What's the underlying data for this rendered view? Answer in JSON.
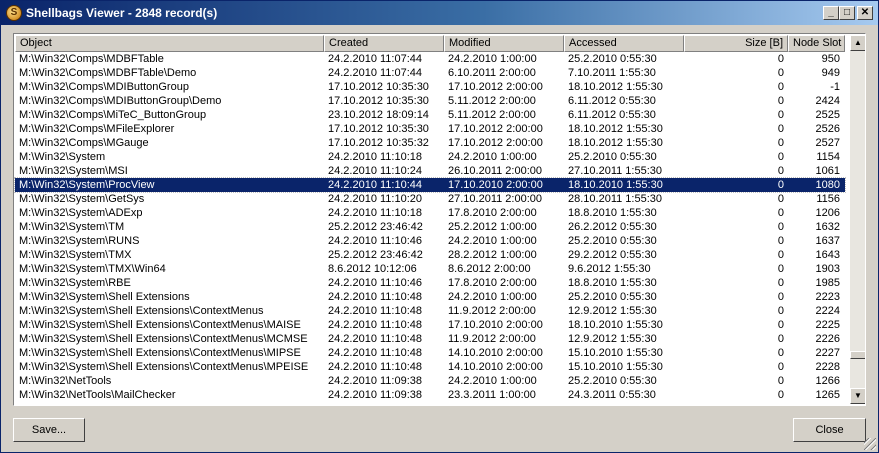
{
  "window": {
    "title": "Shellbags Viewer - 2848 record(s)"
  },
  "columns": [
    "Object",
    "Created",
    "Modified",
    "Accessed",
    "Size [B]",
    "Node Slot"
  ],
  "rows": [
    [
      "M:\\Win32\\Comps\\MDBFTable",
      "24.2.2010 11:07:44",
      "24.2.2010 1:00:00",
      "25.2.2010 0:55:30",
      "0",
      "950"
    ],
    [
      "M:\\Win32\\Comps\\MDBFTable\\Demo",
      "24.2.2010 11:07:44",
      "6.10.2011 2:00:00",
      "7.10.2011 1:55:30",
      "0",
      "949"
    ],
    [
      "M:\\Win32\\Comps\\MDIButtonGroup",
      "17.10.2012 10:35:30",
      "17.10.2012 2:00:00",
      "18.10.2012 1:55:30",
      "0",
      "-1"
    ],
    [
      "M:\\Win32\\Comps\\MDIButtonGroup\\Demo",
      "17.10.2012 10:35:30",
      "5.11.2012 2:00:00",
      "6.11.2012 0:55:30",
      "0",
      "2424"
    ],
    [
      "M:\\Win32\\Comps\\MiTeC_ButtonGroup",
      "23.10.2012 18:09:14",
      "5.11.2012 2:00:00",
      "6.11.2012 0:55:30",
      "0",
      "2525"
    ],
    [
      "M:\\Win32\\Comps\\MFileExplorer",
      "17.10.2012 10:35:30",
      "17.10.2012 2:00:00",
      "18.10.2012 1:55:30",
      "0",
      "2526"
    ],
    [
      "M:\\Win32\\Comps\\MGauge",
      "17.10.2012 10:35:32",
      "17.10.2012 2:00:00",
      "18.10.2012 1:55:30",
      "0",
      "2527"
    ],
    [
      "M:\\Win32\\System",
      "24.2.2010 11:10:18",
      "24.2.2010 1:00:00",
      "25.2.2010 0:55:30",
      "0",
      "1154"
    ],
    [
      "M:\\Win32\\System\\MSI",
      "24.2.2010 11:10:24",
      "26.10.2011 2:00:00",
      "27.10.2011 1:55:30",
      "0",
      "1061"
    ],
    [
      "M:\\Win32\\System\\ProcView",
      "24.2.2010 11:10:44",
      "17.10.2010 2:00:00",
      "18.10.2010 1:55:30",
      "0",
      "1080"
    ],
    [
      "M:\\Win32\\System\\GetSys",
      "24.2.2010 11:10:20",
      "27.10.2011 2:00:00",
      "28.10.2011 1:55:30",
      "0",
      "1156"
    ],
    [
      "M:\\Win32\\System\\ADExp",
      "24.2.2010 11:10:18",
      "17.8.2010 2:00:00",
      "18.8.2010 1:55:30",
      "0",
      "1206"
    ],
    [
      "M:\\Win32\\System\\TM",
      "25.2.2012 23:46:42",
      "25.2.2012 1:00:00",
      "26.2.2012 0:55:30",
      "0",
      "1632"
    ],
    [
      "M:\\Win32\\System\\RUNS",
      "24.2.2010 11:10:46",
      "24.2.2010 1:00:00",
      "25.2.2010 0:55:30",
      "0",
      "1637"
    ],
    [
      "M:\\Win32\\System\\TMX",
      "25.2.2012 23:46:42",
      "28.2.2012 1:00:00",
      "29.2.2012 0:55:30",
      "0",
      "1643"
    ],
    [
      "M:\\Win32\\System\\TMX\\Win64",
      "8.6.2012 10:12:06",
      "8.6.2012 2:00:00",
      "9.6.2012 1:55:30",
      "0",
      "1903"
    ],
    [
      "M:\\Win32\\System\\RBE",
      "24.2.2010 11:10:46",
      "17.8.2010 2:00:00",
      "18.8.2010 1:55:30",
      "0",
      "1985"
    ],
    [
      "M:\\Win32\\System\\Shell Extensions",
      "24.2.2010 11:10:48",
      "24.2.2010 1:00:00",
      "25.2.2010 0:55:30",
      "0",
      "2223"
    ],
    [
      "M:\\Win32\\System\\Shell Extensions\\ContextMenus",
      "24.2.2010 11:10:48",
      "11.9.2012 2:00:00",
      "12.9.2012 1:55:30",
      "0",
      "2224"
    ],
    [
      "M:\\Win32\\System\\Shell Extensions\\ContextMenus\\MAISE",
      "24.2.2010 11:10:48",
      "17.10.2010 2:00:00",
      "18.10.2010 1:55:30",
      "0",
      "2225"
    ],
    [
      "M:\\Win32\\System\\Shell Extensions\\ContextMenus\\MCMSE",
      "24.2.2010 11:10:48",
      "11.9.2012 2:00:00",
      "12.9.2012 1:55:30",
      "0",
      "2226"
    ],
    [
      "M:\\Win32\\System\\Shell Extensions\\ContextMenus\\MIPSE",
      "24.2.2010 11:10:48",
      "14.10.2010 2:00:00",
      "15.10.2010 1:55:30",
      "0",
      "2227"
    ],
    [
      "M:\\Win32\\System\\Shell Extensions\\ContextMenus\\MPEISE",
      "24.2.2010 11:10:48",
      "14.10.2010 2:00:00",
      "15.10.2010 1:55:30",
      "0",
      "2228"
    ],
    [
      "M:\\Win32\\NetTools",
      "24.2.2010 11:09:38",
      "24.2.2010 1:00:00",
      "25.2.2010 0:55:30",
      "0",
      "1266"
    ],
    [
      "M:\\Win32\\NetTools\\MailChecker",
      "24.2.2010 11:09:38",
      "23.3.2011 1:00:00",
      "24.3.2011 0:55:30",
      "0",
      "1265"
    ]
  ],
  "selected_row": 9,
  "buttons": {
    "save": "Save...",
    "close": "Close"
  },
  "colors": {
    "selection": "#0a246a",
    "titlebar": "#0a246a",
    "face": "#d4d0c8"
  },
  "icons": {
    "app": "shellbags-app-icon",
    "minimize": "minimize-icon",
    "maximize": "maximize-icon",
    "close": "close-icon",
    "scroll_up": "arrow-up-icon",
    "scroll_down": "arrow-down-icon"
  }
}
